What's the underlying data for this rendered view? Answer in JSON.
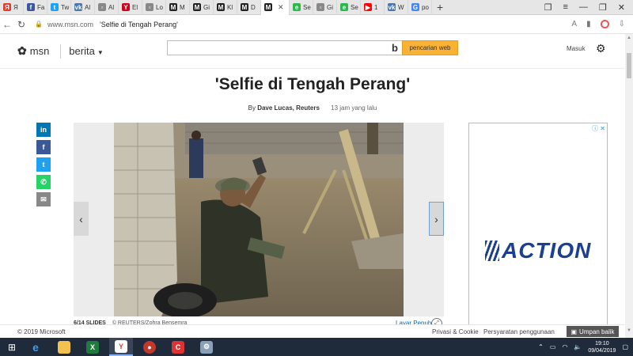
{
  "browser": {
    "tabs": [
      {
        "icon_text": "Я",
        "label": "Я",
        "color": "#e03c31"
      },
      {
        "icon_text": "f",
        "label": "Fa",
        "color": "#3b5998"
      },
      {
        "icon_text": "t",
        "label": "Tw",
        "color": "#1da1f2"
      },
      {
        "icon_text": "vk",
        "label": "Al",
        "color": "#4a76a8"
      },
      {
        "icon_text": "▫",
        "label": "Al",
        "color": "#888888"
      },
      {
        "icon_text": "Y",
        "label": "El",
        "color": "#d0021b"
      },
      {
        "icon_text": "▫",
        "label": "Lo",
        "color": "#888888"
      },
      {
        "icon_text": "M",
        "label": "M",
        "color": "#222222"
      },
      {
        "icon_text": "M",
        "label": "Gi",
        "color": "#222222"
      },
      {
        "icon_text": "M",
        "label": "Kl",
        "color": "#222222"
      },
      {
        "icon_text": "M",
        "label": "D",
        "color": "#222222"
      },
      {
        "icon_text": "M",
        "label": "",
        "color": "#222222",
        "active": true
      },
      {
        "icon_text": "e",
        "label": "Se",
        "color": "#2db84d"
      },
      {
        "icon_text": "▫",
        "label": "Gi",
        "color": "#888888"
      },
      {
        "icon_text": "e",
        "label": "Se",
        "color": "#2db84d"
      },
      {
        "icon_text": "▶",
        "label": "1",
        "color": "#ff0000"
      },
      {
        "icon_text": "vk",
        "label": "W",
        "color": "#4a76a8"
      },
      {
        "icon_text": "G",
        "label": "ро",
        "color": "#4285f4"
      }
    ],
    "newtab_label": "+",
    "address": {
      "domain": "www.msn.com",
      "title": "'Selfie di Tengah Perang'"
    }
  },
  "msn": {
    "logo_text": "msn",
    "section": "berita",
    "search_placeholder": "",
    "search_button": "pencarian web",
    "signin": "Masuk"
  },
  "article": {
    "headline": "'Selfie di Tengah Perang'",
    "by_prefix": "By",
    "author": "Dave Lucas, Reuters",
    "time": "13 jam yang lalu",
    "share": [
      {
        "name": "linkedin",
        "icon_text": "in",
        "color": "#0077b5"
      },
      {
        "name": "facebook",
        "icon_text": "f",
        "color": "#3b5998"
      },
      {
        "name": "twitter",
        "icon_text": "t",
        "color": "#1da1f2"
      },
      {
        "name": "whatsapp",
        "icon_text": "✆",
        "color": "#25d366"
      },
      {
        "name": "email",
        "icon_text": "✉",
        "color": "#888888"
      }
    ],
    "slide_count": "6/14 SLIDES",
    "credit": "© REUTERS/Zohra Bensemra",
    "fullscreen": "Layar Penuh"
  },
  "ad": {
    "brand": "ACTION",
    "brand_color": "#1d3f8f"
  },
  "footer": {
    "copyright": "© 2019 Microsoft",
    "privacy": "Privasi & Cookie",
    "terms": "Persyaratan penggunaan",
    "feedback": "Umpan balik"
  },
  "taskbar": {
    "time": "19:10",
    "date": "09/04/2019"
  }
}
